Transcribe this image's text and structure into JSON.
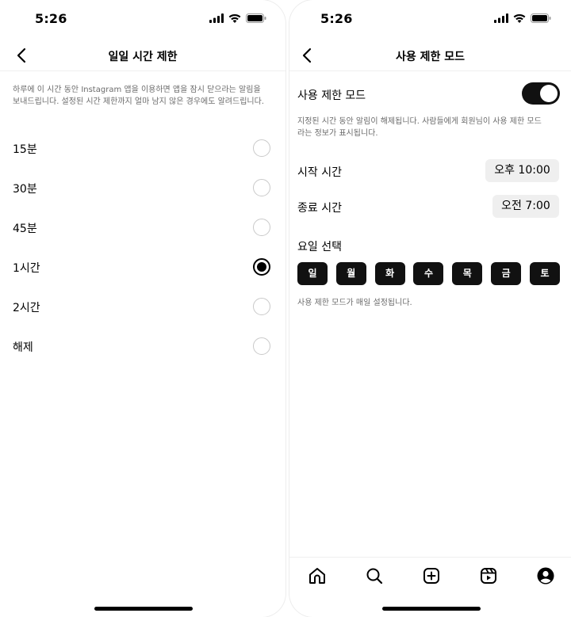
{
  "left": {
    "status_time": "5:26",
    "title": "일일 시간 제한",
    "description": "하루에 이 시간 동안 Instagram 앱을 이용하면 앱을 잠시 닫으라는 알림을 보내드립니다. 설정된 시간 제한까지 얼마 남지 않은 경우에도 알려드립니다.",
    "options": [
      {
        "label": "15분",
        "selected": false
      },
      {
        "label": "30분",
        "selected": false
      },
      {
        "label": "45분",
        "selected": false
      },
      {
        "label": "1시간",
        "selected": true
      },
      {
        "label": "2시간",
        "selected": false
      },
      {
        "label": "해제",
        "selected": false
      }
    ]
  },
  "right": {
    "status_time": "5:26",
    "title": "사용 제한 모드",
    "quiet_mode_label": "사용 제한 모드",
    "quiet_mode_enabled": true,
    "quiet_mode_note": "지정된 시간 동안 알림이 해제됩니다. 사람들에게 회원님이 사용 제한 모드라는 정보가 표시됩니다.",
    "start_label": "시작 시간",
    "start_value": "오후 10:00",
    "end_label": "종료 시간",
    "end_value": "오전 7:00",
    "days_label": "요일 선택",
    "days": [
      "일",
      "월",
      "화",
      "수",
      "목",
      "금",
      "토"
    ],
    "days_note": "사용 제한 모드가 매일 설정됩니다.",
    "tabs": [
      "home-icon",
      "search-icon",
      "create-icon",
      "reels-icon",
      "profile-icon"
    ]
  }
}
